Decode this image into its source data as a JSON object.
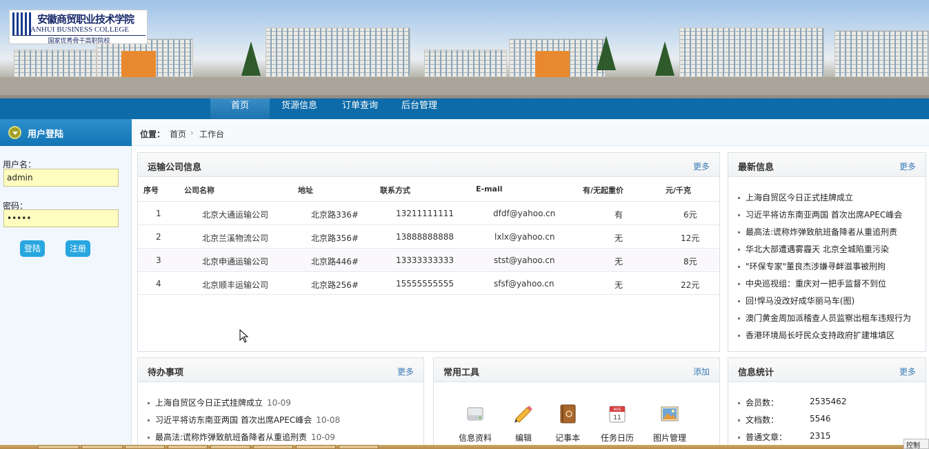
{
  "banner": {
    "logo_cn": "安徽商贸职业技术学院",
    "logo_en": "ANHUI BUSINESS COLLEGE",
    "logo_sub": "国家优秀骨干高职院校"
  },
  "nav": {
    "items": [
      "首页",
      "货源信息",
      "订单查询",
      "后台管理"
    ],
    "active": "首页"
  },
  "sidebar": {
    "title": "用户登陆",
    "username_label": "用户名：",
    "username_value": "admin",
    "password_label": "密码：",
    "password_value": "•••••",
    "login_button": "登陆",
    "register_button": "注册"
  },
  "breadcrumb": {
    "label": "位置：",
    "items": [
      "首页",
      "工作台"
    ],
    "sep": "›"
  },
  "transport": {
    "title": "运输公司信息",
    "more": "更多",
    "headers": [
      "序号",
      "公司名称",
      "地址",
      "联系方式",
      "E-mail",
      "有/无起重价",
      "元/千克"
    ],
    "rows": [
      [
        "1",
        "北京大通运输公司",
        "北京路336#",
        "13211111111",
        "dfdf@yahoo.cn",
        "有",
        "6元"
      ],
      [
        "2",
        "北京兰溪物流公司",
        "北京路356#",
        "13888888888",
        "lxlx@yahoo.cn",
        "无",
        "12元"
      ],
      [
        "3",
        "北京申通运输公司",
        "北京路446#",
        "13333333333",
        "stst@yahoo.cn",
        "无",
        "8元"
      ],
      [
        "4",
        "北京顺丰运输公司",
        "北京路256#",
        "15555555555",
        "sfsf@yahoo.cn",
        "无",
        "22元"
      ]
    ]
  },
  "news": {
    "title": "最新信息",
    "more": "更多",
    "items": [
      "上海自贸区今日正式挂牌成立",
      "习近平将访东南亚两国 首次出席APEC峰会",
      "最高法:谎称炸弹致航班备降者从重追刑责",
      "华北大部遭遇雾霾天 北京全城陷重污染",
      "\"环保专家\"董良杰涉嫌寻衅滋事被刑拘",
      "中央巡视组：重庆对一把手监督不到位",
      "回!悍马没改好成华丽马车(图)",
      "澳门黄金周加派稽查人员监察出租车违规行为",
      "香港环境局长吁民众支持政府扩建堆填区"
    ]
  },
  "todo": {
    "title": "待办事项",
    "more": "更多",
    "items": [
      {
        "text": "上海自贸区今日正式挂牌成立",
        "date": "10-09"
      },
      {
        "text": "习近平将访东南亚两国 首次出席APEC峰会",
        "date": "10-08"
      },
      {
        "text": "最高法:谎称炸弹致航班备降者从重追刑责",
        "date": "10-09"
      }
    ]
  },
  "tools": {
    "title": "常用工具",
    "add": "添加",
    "items": [
      {
        "label": "信息资料",
        "icon": "drive-icon"
      },
      {
        "label": "编辑",
        "icon": "pencil-icon"
      },
      {
        "label": "记事本",
        "icon": "notebook-icon"
      },
      {
        "label": "任务日历",
        "icon": "calendar-icon"
      },
      {
        "label": "图片管理",
        "icon": "picture-icon"
      }
    ],
    "calendar_day": "11",
    "calendar_month": "AUG"
  },
  "stats": {
    "title": "信息统计",
    "more": "更多",
    "items": [
      {
        "label": "会员数：",
        "value": "2535462"
      },
      {
        "label": "文档数：",
        "value": "5546"
      },
      {
        "label": "普通文章：",
        "value": "2315"
      }
    ]
  },
  "taskbar": {
    "tray_label": "控制"
  }
}
